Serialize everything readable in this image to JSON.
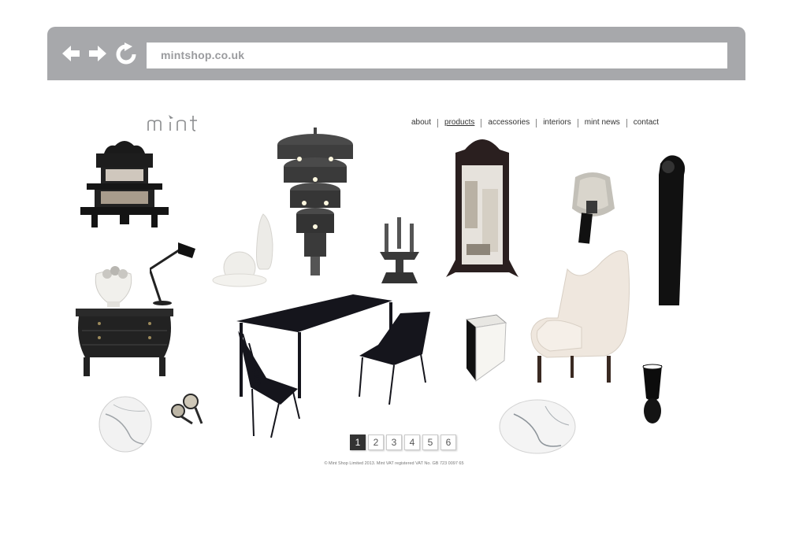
{
  "browser": {
    "url": "mintshop.co.uk",
    "back_icon": "arrow-left-icon",
    "forward_icon": "arrow-right-icon",
    "refresh_icon": "refresh-icon"
  },
  "site": {
    "logo": "mint",
    "nav": [
      {
        "label": "about"
      },
      {
        "label": "products",
        "active": true
      },
      {
        "label": "accessories"
      },
      {
        "label": "interiors"
      },
      {
        "label": "mint news"
      },
      {
        "label": "contact"
      }
    ],
    "pagination": [
      "1",
      "2",
      "3",
      "4",
      "5",
      "6"
    ],
    "current_page": "1",
    "footer": "© Mint Shop Limited 2013. Mint VAT registered VAT No. GB 723 0097 65"
  },
  "colors": {
    "chrome": "#a7a8ab",
    "logo": "#8a8c8e",
    "text": "#333333"
  }
}
